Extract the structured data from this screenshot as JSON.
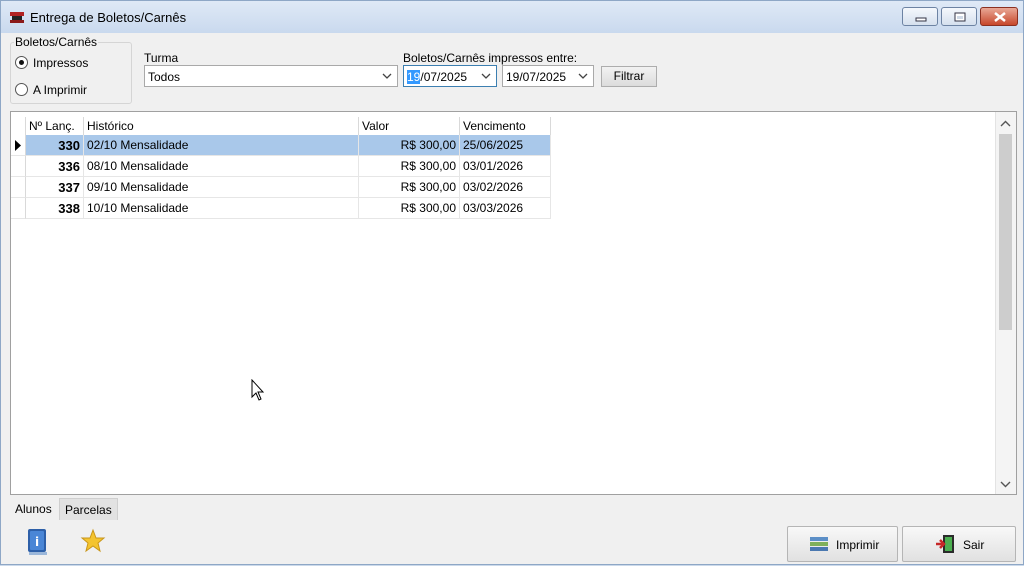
{
  "window": {
    "title": "Entrega de Boletos/Carnês"
  },
  "filter": {
    "group_label": "Boletos/Carnês",
    "radio_impressos": "Impressos",
    "radio_a_imprimir": "A Imprimir",
    "selected_radio": "Impressos",
    "turma_label": "Turma",
    "turma_value": "Todos",
    "date_range_label": "Boletos/Carnês impressos entre:",
    "date_from_highlight": "19",
    "date_from_rest": "/07/2025",
    "date_to": "19/07/2025",
    "filter_button": "Filtrar"
  },
  "grid": {
    "columns": [
      "Nº Lanç.",
      "Histórico",
      "Valor",
      "Vencimento"
    ],
    "rows": [
      {
        "num": "330",
        "historico": "02/10 Mensalidade",
        "valor": "R$ 300,00",
        "vencimento": "25/06/2025",
        "selected": true
      },
      {
        "num": "336",
        "historico": "08/10 Mensalidade",
        "valor": "R$ 300,00",
        "vencimento": "03/01/2026",
        "selected": false
      },
      {
        "num": "337",
        "historico": "09/10 Mensalidade",
        "valor": "R$ 300,00",
        "vencimento": "03/02/2026",
        "selected": false
      },
      {
        "num": "338",
        "historico": "10/10 Mensalidade",
        "valor": "R$ 300,00",
        "vencimento": "03/03/2026",
        "selected": false
      }
    ]
  },
  "tabs": [
    {
      "label": "Alunos",
      "active": true
    },
    {
      "label": "Parcelas",
      "active": false
    }
  ],
  "buttons": {
    "print": "Imprimir",
    "exit": "Sair"
  },
  "icons": {
    "app": "book-icon",
    "print": "printer-icon",
    "exit": "exit-door-icon",
    "info": "info-book-icon",
    "favorite": "star-icon"
  }
}
